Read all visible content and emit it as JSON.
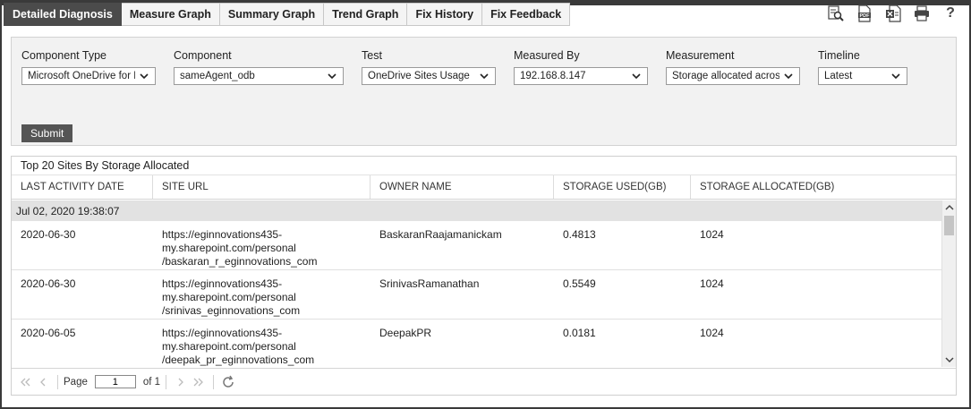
{
  "tabs": [
    {
      "label": "Detailed Diagnosis",
      "active": true
    },
    {
      "label": "Measure Graph",
      "active": false
    },
    {
      "label": "Summary Graph",
      "active": false
    },
    {
      "label": "Trend Graph",
      "active": false
    },
    {
      "label": "Fix History",
      "active": false
    },
    {
      "label": "Fix Feedback",
      "active": false
    }
  ],
  "toolbar": {
    "icons": [
      "zoom-report-icon",
      "pdf-export-icon",
      "excel-export-icon",
      "print-icon",
      "help-icon"
    ],
    "help_label": "?"
  },
  "filters": {
    "component_type": {
      "label": "Component Type",
      "value": "Microsoft OneDrive for B"
    },
    "component": {
      "label": "Component",
      "value": "sameAgent_odb"
    },
    "test": {
      "label": "Test",
      "value": "OneDrive Sites Usage"
    },
    "measured_by": {
      "label": "Measured By",
      "value": "192.168.8.147"
    },
    "measurement": {
      "label": "Measurement",
      "value": "Storage allocated acros"
    },
    "timeline": {
      "label": "Timeline",
      "value": "Latest"
    },
    "submit_label": "Submit"
  },
  "grid": {
    "title": "Top 20 Sites By Storage Allocated",
    "columns": [
      "LAST ACTIVITY DATE",
      "SITE URL",
      "OWNER NAME",
      "STORAGE USED(GB)",
      "STORAGE ALLOCATED(GB)"
    ],
    "group": "Jul 02, 2020 19:38:07",
    "rows": [
      {
        "date": "2020-06-30",
        "url": [
          "https://eginnovations435-",
          "my.sharepoint.com/personal",
          "/baskaran_r_eginnovations_com"
        ],
        "owner": "BaskaranRaajamanickam",
        "used": "0.4813",
        "allocated": "1024"
      },
      {
        "date": "2020-06-30",
        "url": [
          "https://eginnovations435-",
          "my.sharepoint.com/personal",
          "/srinivas_eginnovations_com"
        ],
        "owner": "SrinivasRamanathan",
        "used": "0.5549",
        "allocated": "1024"
      },
      {
        "date": "2020-06-05",
        "url": [
          "https://eginnovations435-",
          "my.sharepoint.com/personal",
          "/deepak_pr_eginnovations_com"
        ],
        "owner": "DeepakPR",
        "used": "0.0181",
        "allocated": "1024"
      }
    ]
  },
  "pager": {
    "page_label": "Page",
    "page_value": "1",
    "of_label": "of 1"
  },
  "colors": {
    "active_tab": "#4b4b4b",
    "panel_bg": "#f2f2f2",
    "group_row": "#e2e2e2",
    "submit_bg": "#555555"
  }
}
